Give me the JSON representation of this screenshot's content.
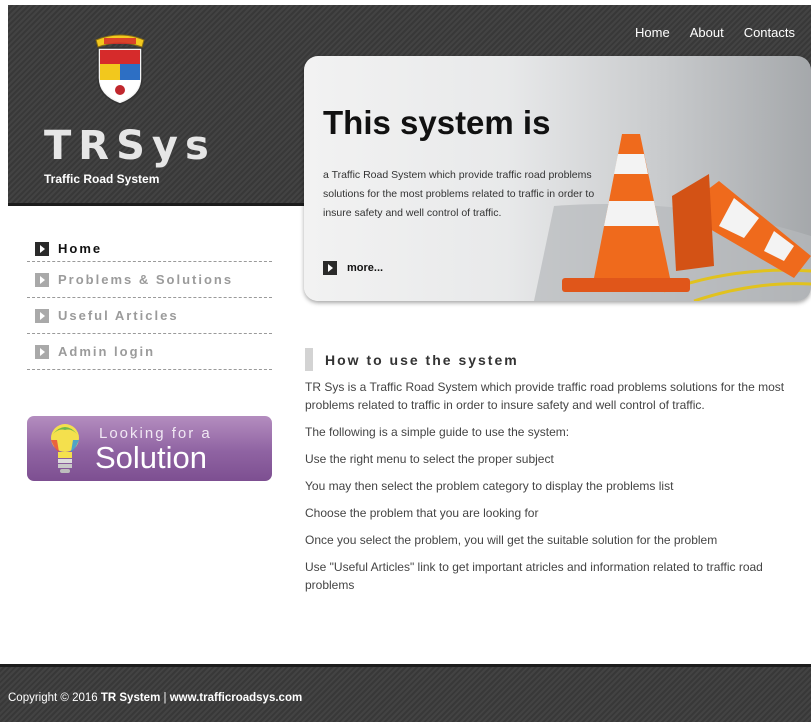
{
  "header": {
    "brand": "TRSys",
    "subtitle": "Traffic Road System"
  },
  "topnav": [
    "Home",
    "About",
    "Contacts"
  ],
  "hero": {
    "title": "This system is",
    "text": "a Traffic Road System which provide traffic road problems solutions for the most problems related to traffic in order to insure safety and well control of traffic.",
    "more": "more..."
  },
  "sidemenu": [
    {
      "label": "Home",
      "active": true
    },
    {
      "label": "Problems & Solutions",
      "active": false
    },
    {
      "label": "Useful Articles",
      "active": false
    },
    {
      "label": "Admin login",
      "active": false
    }
  ],
  "banner": {
    "top": "Looking for a",
    "main": "Solution"
  },
  "content": {
    "title": "How to use the system",
    "paragraphs": [
      "TR Sys is a Traffic Road System which provide traffic road problems solutions for the most problems related to traffic in order to insure safety and well control of traffic.",
      "The following is a simple guide to use the system:",
      "Use the right menu to select the proper subject",
      "You may then select the problem category to display the problems list",
      "Choose the problem that you are looking for",
      "Once you select the problem, you will get the suitable solution for the problem",
      "Use \"Useful Articles\" link to get important atricles and information related to traffic road problems"
    ]
  },
  "footer": {
    "prefix": "Copyright © 2016 ",
    "company": "TR System",
    "separator": " | ",
    "site": "www.trafficroadsys.com"
  }
}
